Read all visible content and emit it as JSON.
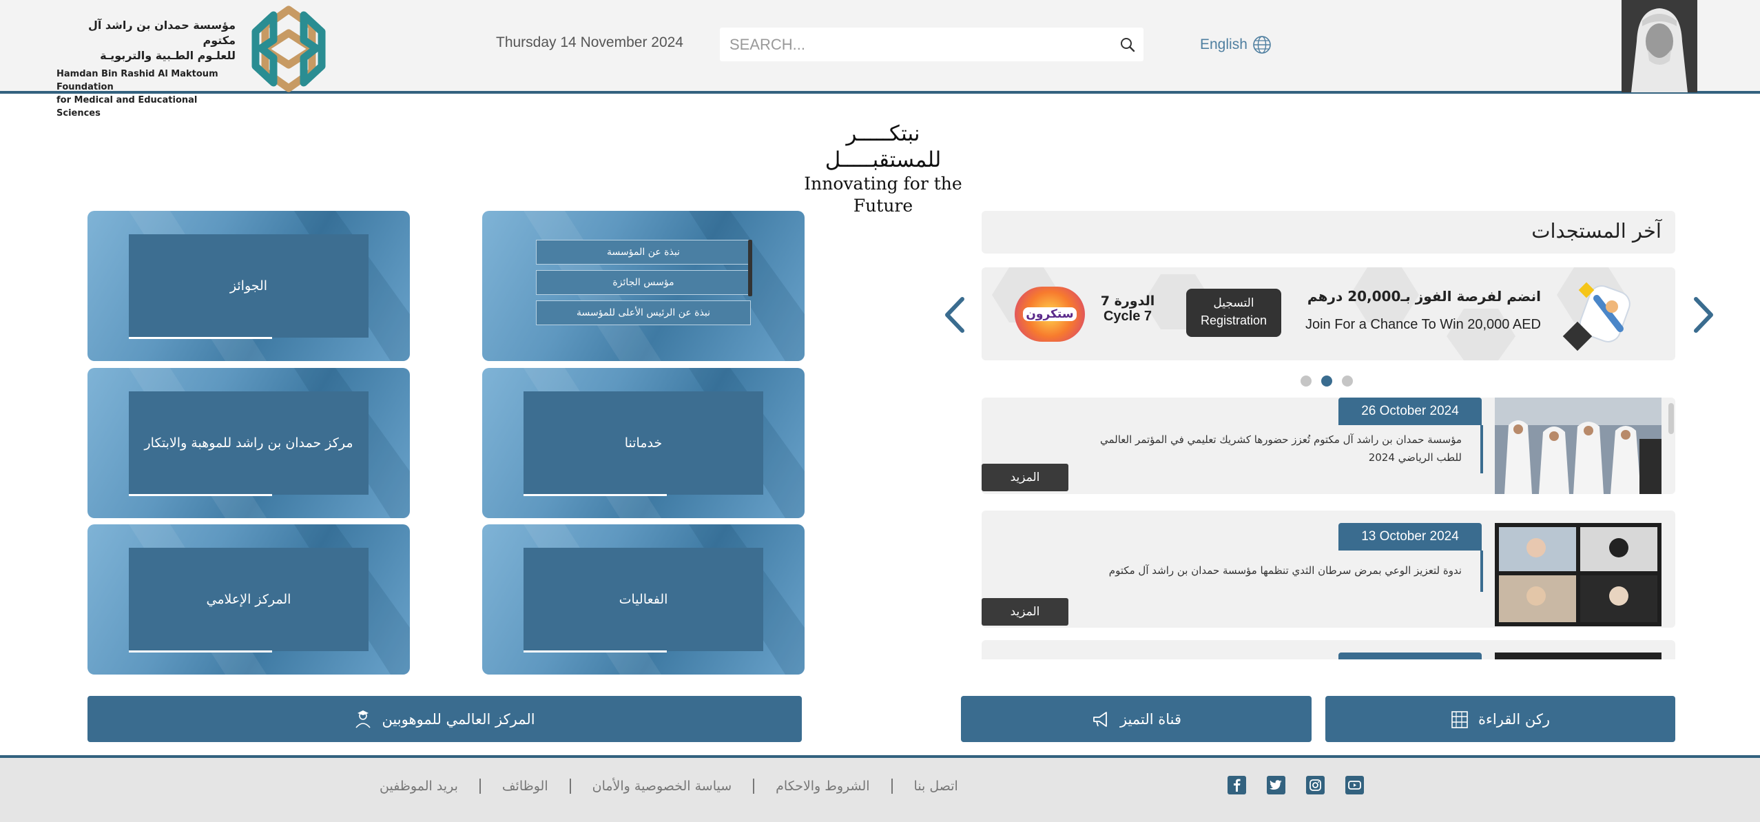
{
  "header": {
    "logo_ar_line1": "مؤسسة حمدان بن راشد آل مكتوم",
    "logo_ar_line2": "للعلـوم الطـبية والتربويـة",
    "logo_en_line1": "Hamdan Bin Rashid Al Maktoum Foundation",
    "logo_en_line2": "for Medical and Educational Sciences",
    "date": "Thursday 14 November 2024",
    "search_placeholder": "SEARCH...",
    "language_label": "English"
  },
  "slogan": {
    "ar": "نبتكـــــر للمستقبـــــل",
    "en": "Innovating for the Future"
  },
  "tiles": {
    "about_items": [
      "نبذة عن المؤسسة",
      "مؤسس الجائزة",
      "نبذة عن الرئيس الأعلى للمؤسسة"
    ],
    "awards": "الجوائز",
    "services": "خدماتنا",
    "talent_center": "مركز حمدان بن راشد للموهبة والابتكار",
    "events": "الفعاليات",
    "media_center": "المركز الإعلامي"
  },
  "bottom_buttons": {
    "gifted_center": "المركز العالمي للموهوبين",
    "excellence_channel": "قناة التميز",
    "reading_corner": "ركن القراءة"
  },
  "news": {
    "title": "آخر المستجدات",
    "banner": {
      "ar_headline": "انضم لفرصة الفوز بـ20,000 درهم",
      "en_headline": "Join For a Chance To Win 20,000 AED",
      "register_ar": "التسجيل",
      "register_en": "Registration",
      "cycle_ar": "الدورة 7",
      "cycle_en": "Cycle 7",
      "brand": "ستكرون"
    },
    "carousel_active_index": 1,
    "items": [
      {
        "date": "26 October 2024",
        "text": "مؤسسة حمدان بن راشد آل مكتوم تُعزز حضورها كشريك تعليمي في المؤتمر العالمي للطب الرياضي 2024",
        "more": "المزيد"
      },
      {
        "date": "13 October 2024",
        "text": "ندوة لتعزيز الوعي بمرض سرطان الثدي تنظمها مؤسسة حمدان بن راشد آل مكتوم",
        "more": "المزيد"
      }
    ]
  },
  "footer": {
    "links": [
      "اتصل بنا",
      "الشروط والاحكام",
      "سياسة الخصوصية والأمان",
      "الوظائف",
      "بريد الموظفين"
    ],
    "social": [
      "youtube-icon",
      "instagram-icon",
      "twitter-icon",
      "facebook-icon"
    ]
  },
  "colors": {
    "primary": "#3a6c8f",
    "header_border": "#33627f",
    "tile_light": "#7fb3d6"
  }
}
